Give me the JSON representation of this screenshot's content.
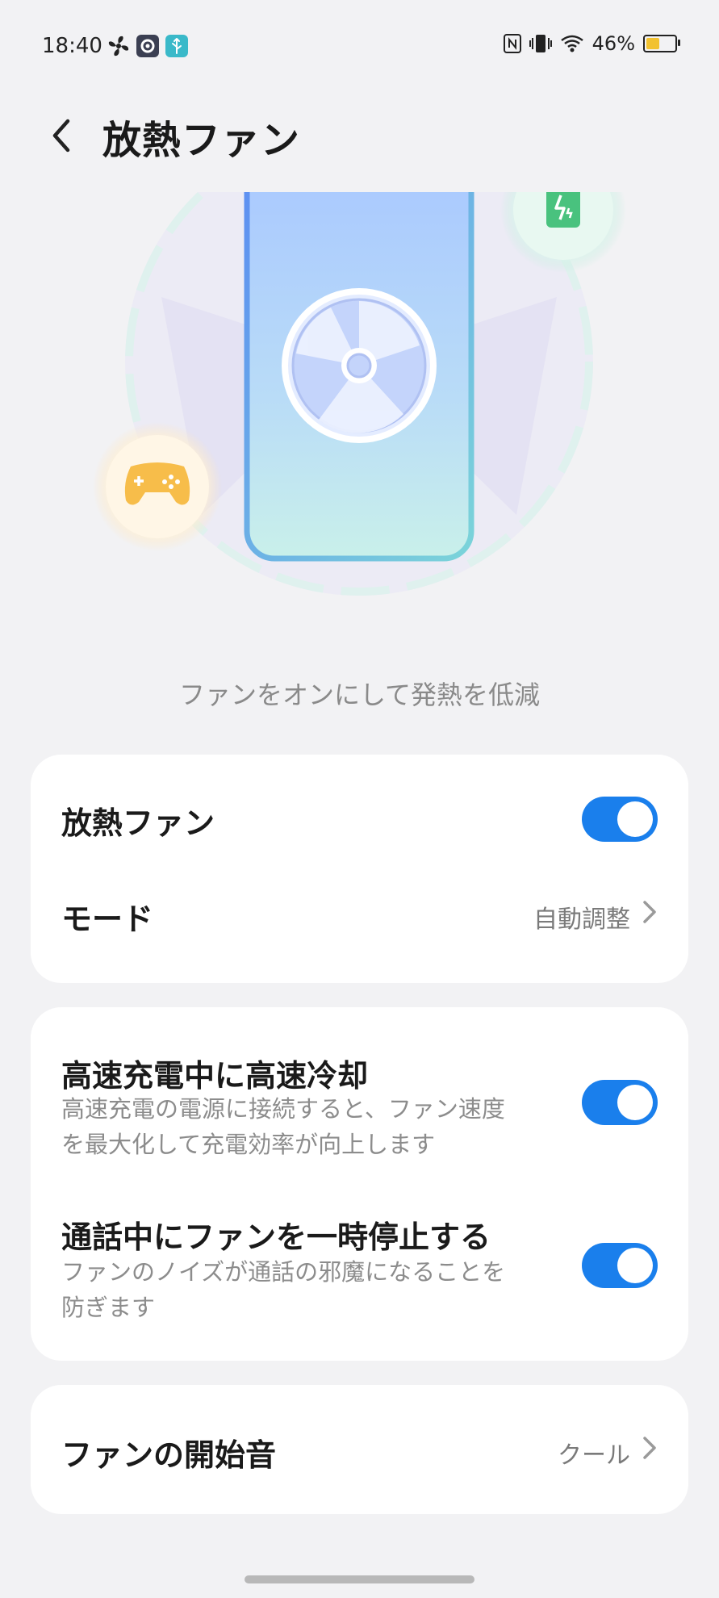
{
  "status_bar": {
    "time": "18:40",
    "battery_text": "46%",
    "battery_level": 0.46,
    "left_icons": [
      "fan-icon",
      "gear-icon",
      "usb-icon"
    ],
    "right_icons": [
      "nfc-icon",
      "vibrate-icon",
      "wifi-icon",
      "battery-icon"
    ]
  },
  "header": {
    "title": "放熱ファン",
    "back_icon": "chevron-left-icon"
  },
  "hero": {
    "caption": "ファンをオンにして発熱を低減",
    "icons": [
      "fan-icon",
      "gamepad-icon",
      "charging-battery-icon"
    ]
  },
  "card_main": {
    "fan_label": "放熱ファン",
    "fan_enabled": true,
    "mode_label": "モード",
    "mode_value": "自動調整"
  },
  "card_options": {
    "fast_cool_title": "高速充電中に高速冷却",
    "fast_cool_desc": "高速充電の電源に接続すると、ファン速度を最大化して充電効率が向上します",
    "fast_cool_enabled": true,
    "pause_call_title": "通話中にファンを一時停止する",
    "pause_call_desc": "ファンのノイズが通話の邪魔になることを防ぎます",
    "pause_call_enabled": true
  },
  "card_sound": {
    "label": "ファンの開始音",
    "value": "クール"
  },
  "colors": {
    "accent": "#1a7fec",
    "background": "#f2f2f4",
    "card": "#ffffff"
  }
}
